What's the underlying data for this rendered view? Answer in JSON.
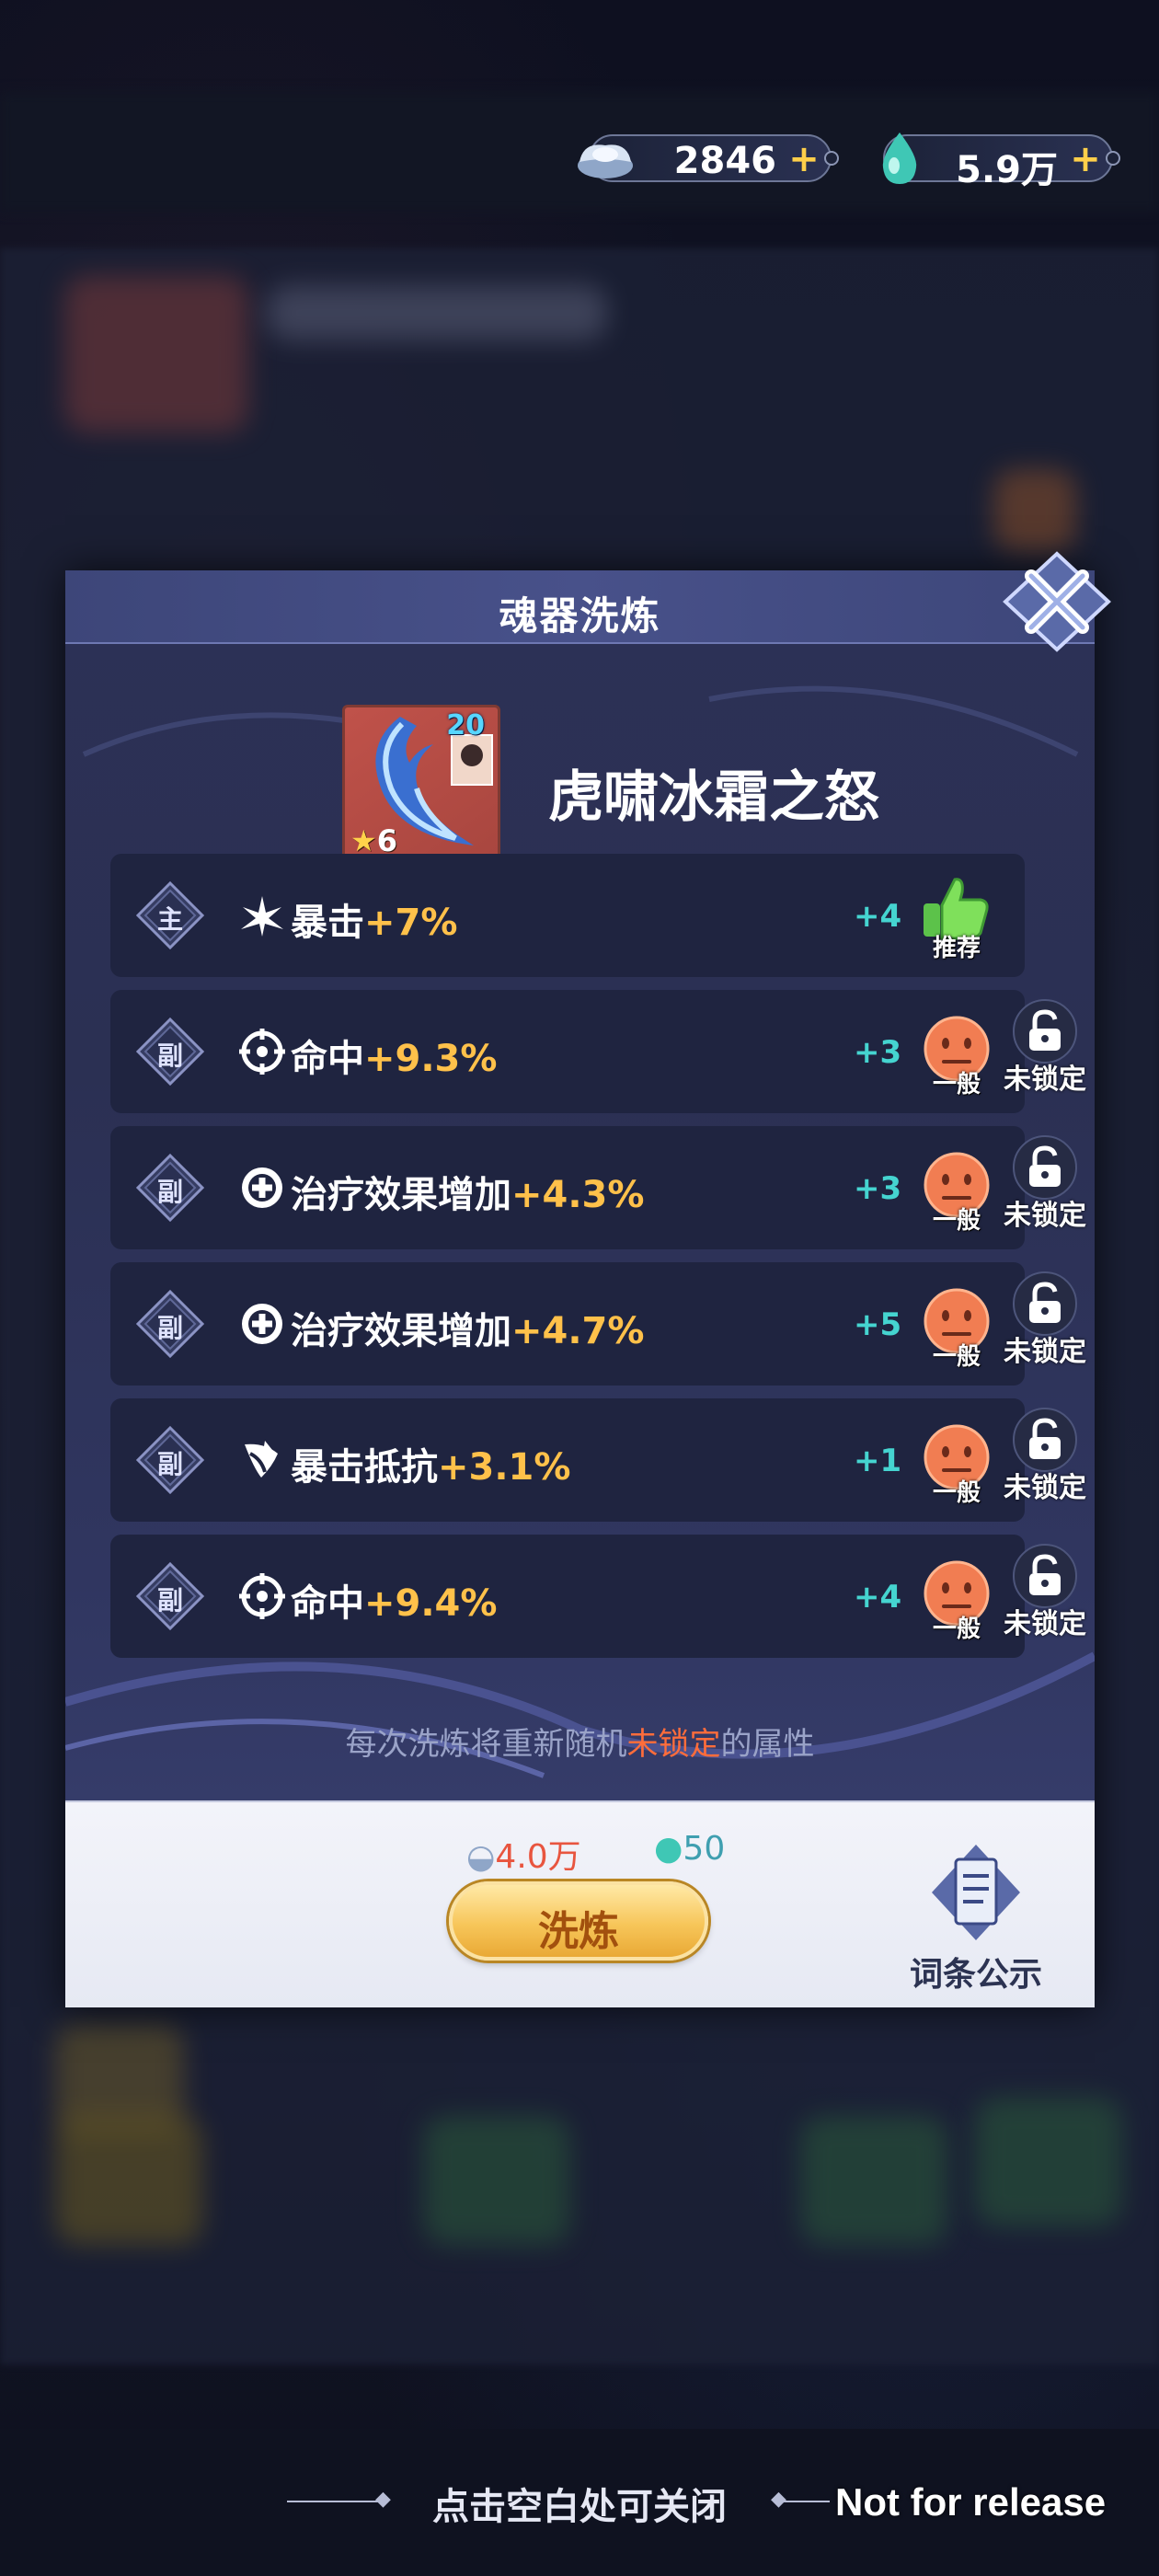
{
  "currency": {
    "silver": {
      "value": "2846",
      "icon": "silver-ingot-icon",
      "plus": "+"
    },
    "essence": {
      "value": "5.9万",
      "icon": "spirit-drop-icon",
      "plus": "+"
    }
  },
  "modal": {
    "title": "魂器洗炼",
    "item": {
      "name": "虎啸冰霜之怒",
      "level": "20",
      "stars": "6"
    },
    "attributes": [
      {
        "type": "主",
        "icon": "critical-strike-icon",
        "name": "暴击",
        "value": "+7%",
        "bonus": "+4",
        "rating": "推荐",
        "rating_icon": "thumbs-up-icon",
        "lock": null
      },
      {
        "type": "副",
        "icon": "crosshair-icon",
        "name": "命中",
        "value": "+9.3%",
        "bonus": "+3",
        "rating": "一般",
        "rating_icon": "neutral-face-icon",
        "lock": "未锁定"
      },
      {
        "type": "副",
        "icon": "heal-cross-icon",
        "name": "治疗效果增加",
        "value": "+4.3%",
        "bonus": "+3",
        "rating": "一般",
        "rating_icon": "neutral-face-icon",
        "lock": "未锁定"
      },
      {
        "type": "副",
        "icon": "heal-cross-icon",
        "name": "治疗效果增加",
        "value": "+4.7%",
        "bonus": "+5",
        "rating": "一般",
        "rating_icon": "neutral-face-icon",
        "lock": "未锁定"
      },
      {
        "type": "副",
        "icon": "crit-resist-icon",
        "name": "暴击抵抗",
        "value": "+3.1%",
        "bonus": "+1",
        "rating": "一般",
        "rating_icon": "neutral-face-icon",
        "lock": "未锁定"
      },
      {
        "type": "副",
        "icon": "crosshair-icon",
        "name": "命中",
        "value": "+9.4%",
        "bonus": "+4",
        "rating": "一般",
        "rating_icon": "neutral-face-icon",
        "lock": "未锁定"
      }
    ],
    "hint": {
      "prefix": "每次洗炼将重新随机",
      "highlight": "未锁定",
      "suffix": "的属性"
    },
    "cost": {
      "silver": "4.0万",
      "essence": "50"
    },
    "wash_button": "洗炼",
    "glossary_button": "词条公示"
  },
  "footer_tip": "点击空白处可关闭",
  "watermark": "Not for release",
  "colors": {
    "value_gold": "#ffc14a",
    "bonus_teal": "#45d4d0",
    "warn_orange": "#ff6d3b",
    "button_gold": "#f7c65a"
  }
}
